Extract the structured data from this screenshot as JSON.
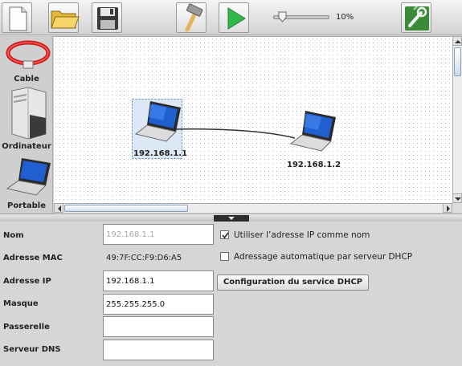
{
  "toolbar": {
    "buttons": [
      "new-file",
      "open-folder",
      "save",
      "build-hammer",
      "run-simulation",
      "settings-tool"
    ],
    "zoom_value": 0.1,
    "zoom_label": "10%"
  },
  "palette": {
    "items": [
      {
        "label": "Cable",
        "icon": "cable-icon"
      },
      {
        "label": "Ordinateur",
        "icon": "computer-icon"
      },
      {
        "label": "Portable",
        "icon": "laptop-icon"
      }
    ]
  },
  "canvas": {
    "hosts": [
      {
        "ip": "192.168.1.1",
        "selected": true
      },
      {
        "ip": "192.168.1.2",
        "selected": false
      }
    ]
  },
  "properties": {
    "nom_label": "Nom",
    "nom_value": "192.168.1.1",
    "mac_label": "Adresse MAC",
    "mac_value": "49:7F:CC:F9:D6:A5",
    "ip_label": "Adresse IP",
    "ip_value": "192.168.1.1",
    "masque_label": "Masque",
    "masque_value": "255.255.255.0",
    "passerelle_label": "Passerelle",
    "passerelle_value": "",
    "dns_label": "Serveur DNS",
    "dns_value": "",
    "use_ip_as_name_label": "Utiliser l’adresse IP comme nom",
    "use_ip_as_name_checked": true,
    "dhcp_auto_label": "Adressage automatique par serveur DHCP",
    "dhcp_auto_checked": false,
    "dhcp_config_button": "Configuration du service DHCP"
  },
  "colors": {
    "selection_fill": "#dce8f6",
    "selection_border": "#5a7fb0",
    "link_line": "#333333",
    "run_green": "#2fb84a"
  }
}
